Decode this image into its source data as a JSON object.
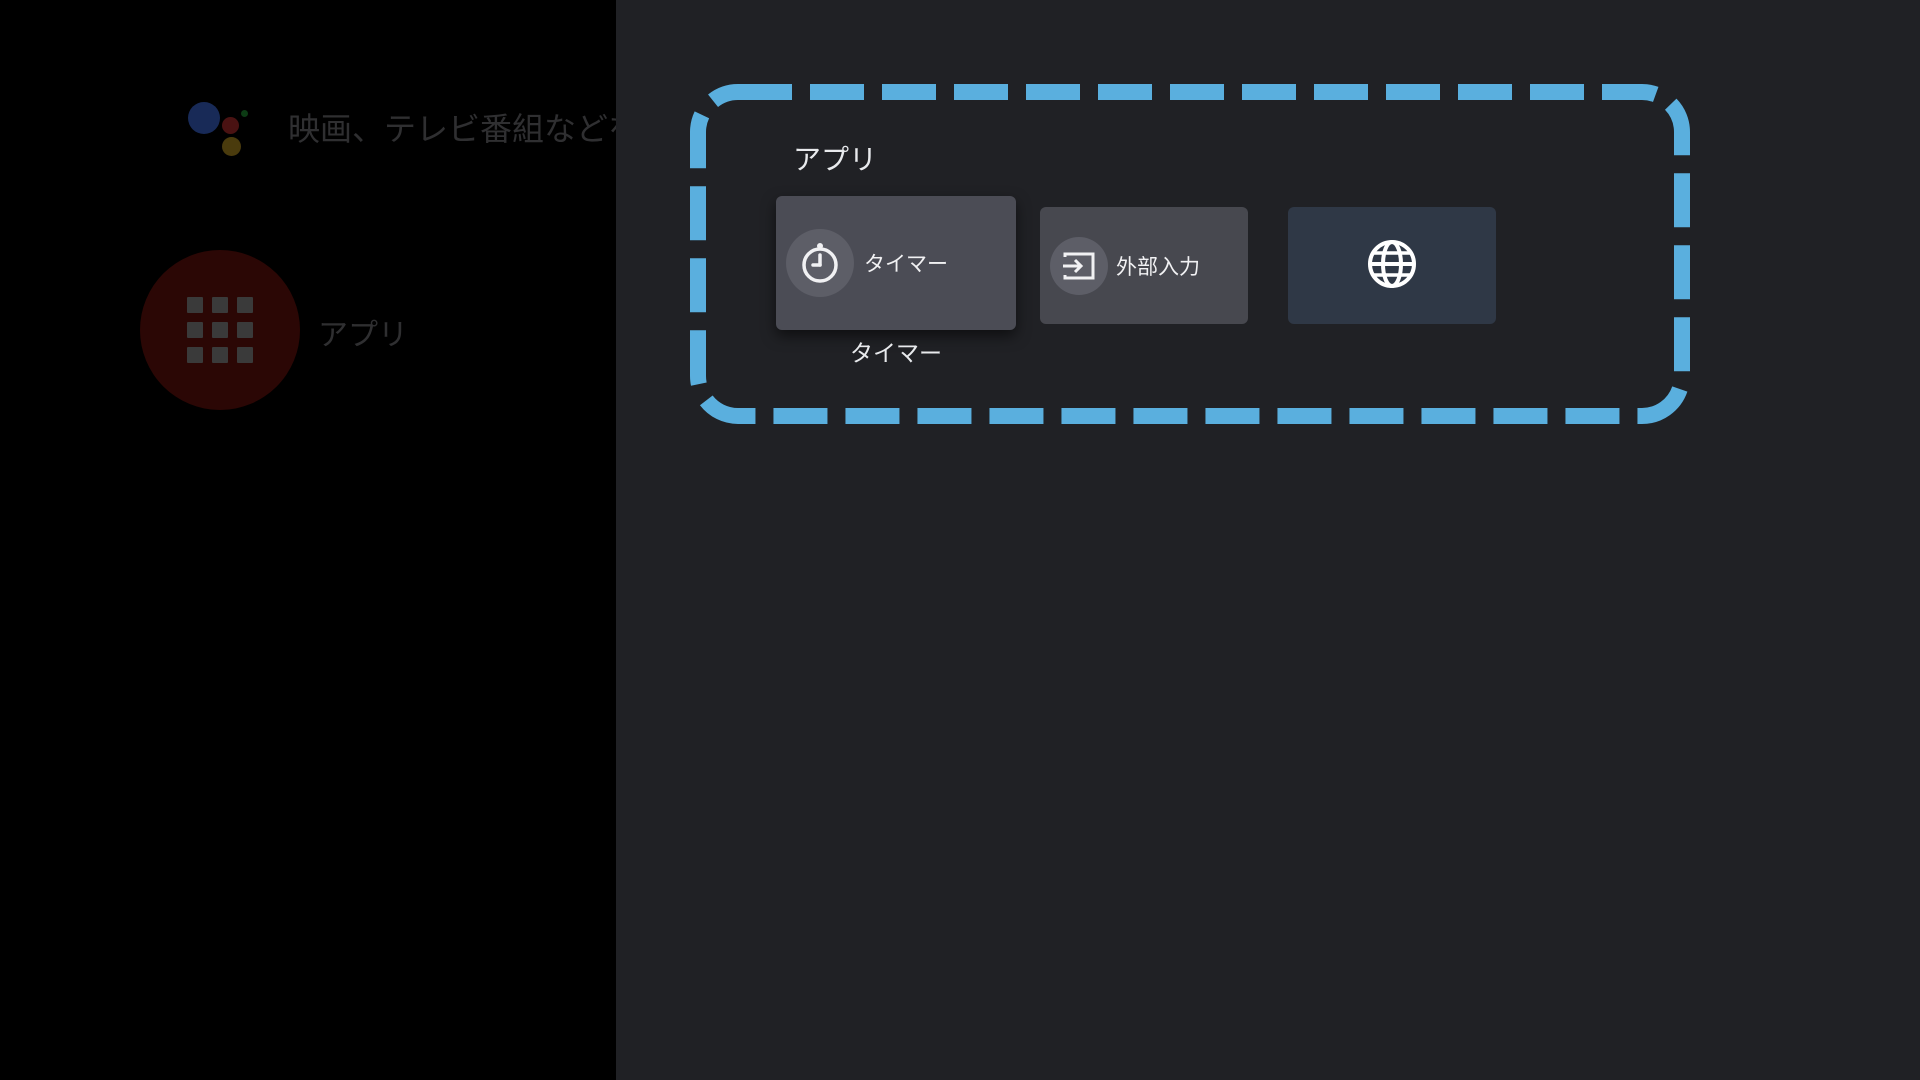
{
  "background_screen": {
    "search_hint": "映画、テレビ番組などを",
    "apps_label": "アプリ"
  },
  "panel": {
    "section_title": "アプリ",
    "highlight_color": "#5aafde",
    "tiles": [
      {
        "label": "タイマー",
        "icon": "timer-icon",
        "focused": true,
        "caption": "タイマー"
      },
      {
        "label": "外部入力",
        "icon": "input-source-icon",
        "focused": false
      },
      {
        "label": "",
        "icon": "globe-icon",
        "focused": false
      }
    ]
  }
}
